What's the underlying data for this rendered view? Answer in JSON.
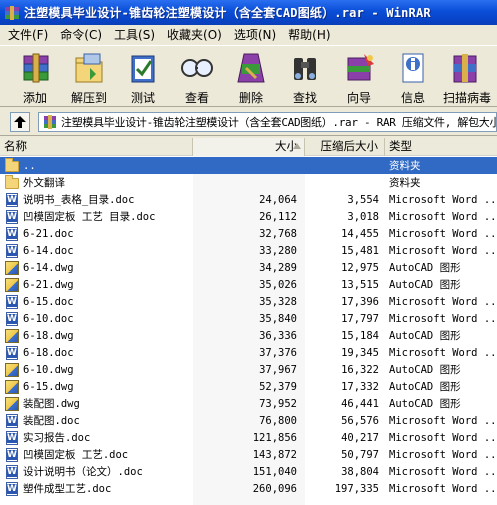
{
  "window": {
    "title": "注塑模具毕业设计-锥齿轮注塑模设计（含全套CAD图纸）.rar - WinRAR"
  },
  "menu": [
    "文件(F)",
    "命令(C)",
    "工具(S)",
    "收藏夹(O)",
    "选项(N)",
    "帮助(H)"
  ],
  "toolbar": [
    {
      "label": "添加",
      "icon": "add-archive-icon"
    },
    {
      "label": "解压到",
      "icon": "extract-to-icon"
    },
    {
      "label": "测试",
      "icon": "test-icon"
    },
    {
      "label": "查看",
      "icon": "view-icon"
    },
    {
      "label": "删除",
      "icon": "delete-icon"
    },
    {
      "label": "查找",
      "icon": "find-icon"
    },
    {
      "label": "向导",
      "icon": "wizard-icon"
    },
    {
      "label": "信息",
      "icon": "info-icon"
    },
    {
      "label": "扫描病毒",
      "icon": "scan-virus-icon"
    }
  ],
  "address": {
    "text": "注塑模具毕业设计-锥齿轮注塑模设计（含全套CAD图纸）.rar - RAR 压缩文件, 解包大小为"
  },
  "columns": {
    "name": "名称",
    "size": "大小",
    "packed": "压缩后大小",
    "type": "类型"
  },
  "files": [
    {
      "name": "..",
      "size": "",
      "packed": "",
      "type": "资料夹",
      "icon": "folder-up",
      "selected": true
    },
    {
      "name": "外文翻译",
      "size": "",
      "packed": "",
      "type": "资料夹",
      "icon": "folder"
    },
    {
      "name": "说明书_表格_目录.doc",
      "size": "24,064",
      "packed": "3,554",
      "type": "Microsoft Word ...",
      "icon": "doc"
    },
    {
      "name": "凹模固定板 工艺  目录.doc",
      "size": "26,112",
      "packed": "3,018",
      "type": "Microsoft Word ...",
      "icon": "doc"
    },
    {
      "name": "6-21.doc",
      "size": "32,768",
      "packed": "14,455",
      "type": "Microsoft Word ...",
      "icon": "doc"
    },
    {
      "name": "6-14.doc",
      "size": "33,280",
      "packed": "15,481",
      "type": "Microsoft Word ...",
      "icon": "doc"
    },
    {
      "name": "6-14.dwg",
      "size": "34,289",
      "packed": "12,975",
      "type": "AutoCAD 图形",
      "icon": "dwg"
    },
    {
      "name": "6-21.dwg",
      "size": "35,026",
      "packed": "13,515",
      "type": "AutoCAD 图形",
      "icon": "dwg"
    },
    {
      "name": "6-15.doc",
      "size": "35,328",
      "packed": "17,396",
      "type": "Microsoft Word ...",
      "icon": "doc"
    },
    {
      "name": "6-10.doc",
      "size": "35,840",
      "packed": "17,797",
      "type": "Microsoft Word ...",
      "icon": "doc"
    },
    {
      "name": "6-18.dwg",
      "size": "36,336",
      "packed": "15,184",
      "type": "AutoCAD 图形",
      "icon": "dwg"
    },
    {
      "name": "6-18.doc",
      "size": "37,376",
      "packed": "19,345",
      "type": "Microsoft Word ...",
      "icon": "doc"
    },
    {
      "name": "6-10.dwg",
      "size": "37,967",
      "packed": "16,322",
      "type": "AutoCAD 图形",
      "icon": "dwg"
    },
    {
      "name": "6-15.dwg",
      "size": "52,379",
      "packed": "17,332",
      "type": "AutoCAD 图形",
      "icon": "dwg"
    },
    {
      "name": "装配图.dwg",
      "size": "73,952",
      "packed": "46,441",
      "type": "AutoCAD 图形",
      "icon": "dwg"
    },
    {
      "name": "装配图.doc",
      "size": "76,800",
      "packed": "56,576",
      "type": "Microsoft Word ...",
      "icon": "doc"
    },
    {
      "name": "实习报告.doc",
      "size": "121,856",
      "packed": "40,217",
      "type": "Microsoft Word ...",
      "icon": "doc"
    },
    {
      "name": "凹模固定板 工艺.doc",
      "size": "143,872",
      "packed": "50,797",
      "type": "Microsoft Word ...",
      "icon": "doc"
    },
    {
      "name": "设计说明书（论文）.doc",
      "size": "151,040",
      "packed": "38,804",
      "type": "Microsoft Word ...",
      "icon": "doc"
    },
    {
      "name": "塑件成型工艺.doc",
      "size": "260,096",
      "packed": "197,335",
      "type": "Microsoft Word ...",
      "icon": "doc"
    }
  ]
}
